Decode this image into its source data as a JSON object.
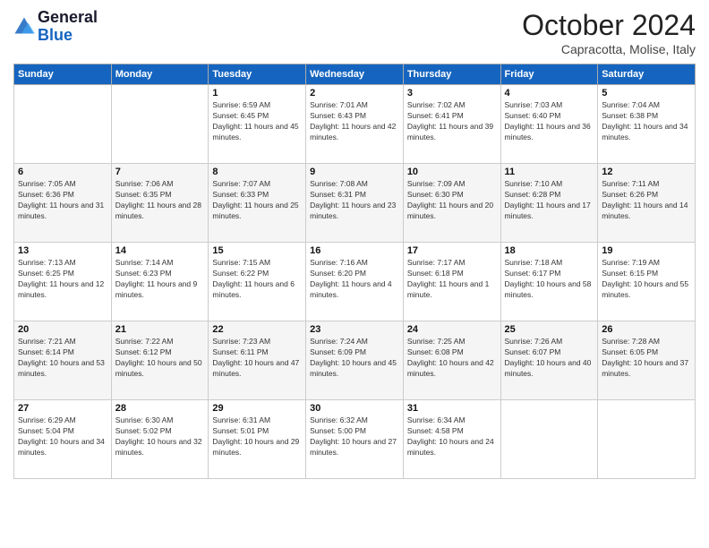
{
  "logo": {
    "line1": "General",
    "line2": "Blue"
  },
  "title": "October 2024",
  "subtitle": "Capracotta, Molise, Italy",
  "days_of_week": [
    "Sunday",
    "Monday",
    "Tuesday",
    "Wednesday",
    "Thursday",
    "Friday",
    "Saturday"
  ],
  "weeks": [
    [
      {
        "day": "",
        "info": ""
      },
      {
        "day": "",
        "info": ""
      },
      {
        "day": "1",
        "info": "Sunrise: 6:59 AM\nSunset: 6:45 PM\nDaylight: 11 hours and 45 minutes."
      },
      {
        "day": "2",
        "info": "Sunrise: 7:01 AM\nSunset: 6:43 PM\nDaylight: 11 hours and 42 minutes."
      },
      {
        "day": "3",
        "info": "Sunrise: 7:02 AM\nSunset: 6:41 PM\nDaylight: 11 hours and 39 minutes."
      },
      {
        "day": "4",
        "info": "Sunrise: 7:03 AM\nSunset: 6:40 PM\nDaylight: 11 hours and 36 minutes."
      },
      {
        "day": "5",
        "info": "Sunrise: 7:04 AM\nSunset: 6:38 PM\nDaylight: 11 hours and 34 minutes."
      }
    ],
    [
      {
        "day": "6",
        "info": "Sunrise: 7:05 AM\nSunset: 6:36 PM\nDaylight: 11 hours and 31 minutes."
      },
      {
        "day": "7",
        "info": "Sunrise: 7:06 AM\nSunset: 6:35 PM\nDaylight: 11 hours and 28 minutes."
      },
      {
        "day": "8",
        "info": "Sunrise: 7:07 AM\nSunset: 6:33 PM\nDaylight: 11 hours and 25 minutes."
      },
      {
        "day": "9",
        "info": "Sunrise: 7:08 AM\nSunset: 6:31 PM\nDaylight: 11 hours and 23 minutes."
      },
      {
        "day": "10",
        "info": "Sunrise: 7:09 AM\nSunset: 6:30 PM\nDaylight: 11 hours and 20 minutes."
      },
      {
        "day": "11",
        "info": "Sunrise: 7:10 AM\nSunset: 6:28 PM\nDaylight: 11 hours and 17 minutes."
      },
      {
        "day": "12",
        "info": "Sunrise: 7:11 AM\nSunset: 6:26 PM\nDaylight: 11 hours and 14 minutes."
      }
    ],
    [
      {
        "day": "13",
        "info": "Sunrise: 7:13 AM\nSunset: 6:25 PM\nDaylight: 11 hours and 12 minutes."
      },
      {
        "day": "14",
        "info": "Sunrise: 7:14 AM\nSunset: 6:23 PM\nDaylight: 11 hours and 9 minutes."
      },
      {
        "day": "15",
        "info": "Sunrise: 7:15 AM\nSunset: 6:22 PM\nDaylight: 11 hours and 6 minutes."
      },
      {
        "day": "16",
        "info": "Sunrise: 7:16 AM\nSunset: 6:20 PM\nDaylight: 11 hours and 4 minutes."
      },
      {
        "day": "17",
        "info": "Sunrise: 7:17 AM\nSunset: 6:18 PM\nDaylight: 11 hours and 1 minute."
      },
      {
        "day": "18",
        "info": "Sunrise: 7:18 AM\nSunset: 6:17 PM\nDaylight: 10 hours and 58 minutes."
      },
      {
        "day": "19",
        "info": "Sunrise: 7:19 AM\nSunset: 6:15 PM\nDaylight: 10 hours and 55 minutes."
      }
    ],
    [
      {
        "day": "20",
        "info": "Sunrise: 7:21 AM\nSunset: 6:14 PM\nDaylight: 10 hours and 53 minutes."
      },
      {
        "day": "21",
        "info": "Sunrise: 7:22 AM\nSunset: 6:12 PM\nDaylight: 10 hours and 50 minutes."
      },
      {
        "day": "22",
        "info": "Sunrise: 7:23 AM\nSunset: 6:11 PM\nDaylight: 10 hours and 47 minutes."
      },
      {
        "day": "23",
        "info": "Sunrise: 7:24 AM\nSunset: 6:09 PM\nDaylight: 10 hours and 45 minutes."
      },
      {
        "day": "24",
        "info": "Sunrise: 7:25 AM\nSunset: 6:08 PM\nDaylight: 10 hours and 42 minutes."
      },
      {
        "day": "25",
        "info": "Sunrise: 7:26 AM\nSunset: 6:07 PM\nDaylight: 10 hours and 40 minutes."
      },
      {
        "day": "26",
        "info": "Sunrise: 7:28 AM\nSunset: 6:05 PM\nDaylight: 10 hours and 37 minutes."
      }
    ],
    [
      {
        "day": "27",
        "info": "Sunrise: 6:29 AM\nSunset: 5:04 PM\nDaylight: 10 hours and 34 minutes."
      },
      {
        "day": "28",
        "info": "Sunrise: 6:30 AM\nSunset: 5:02 PM\nDaylight: 10 hours and 32 minutes."
      },
      {
        "day": "29",
        "info": "Sunrise: 6:31 AM\nSunset: 5:01 PM\nDaylight: 10 hours and 29 minutes."
      },
      {
        "day": "30",
        "info": "Sunrise: 6:32 AM\nSunset: 5:00 PM\nDaylight: 10 hours and 27 minutes."
      },
      {
        "day": "31",
        "info": "Sunrise: 6:34 AM\nSunset: 4:58 PM\nDaylight: 10 hours and 24 minutes."
      },
      {
        "day": "",
        "info": ""
      },
      {
        "day": "",
        "info": ""
      }
    ]
  ]
}
